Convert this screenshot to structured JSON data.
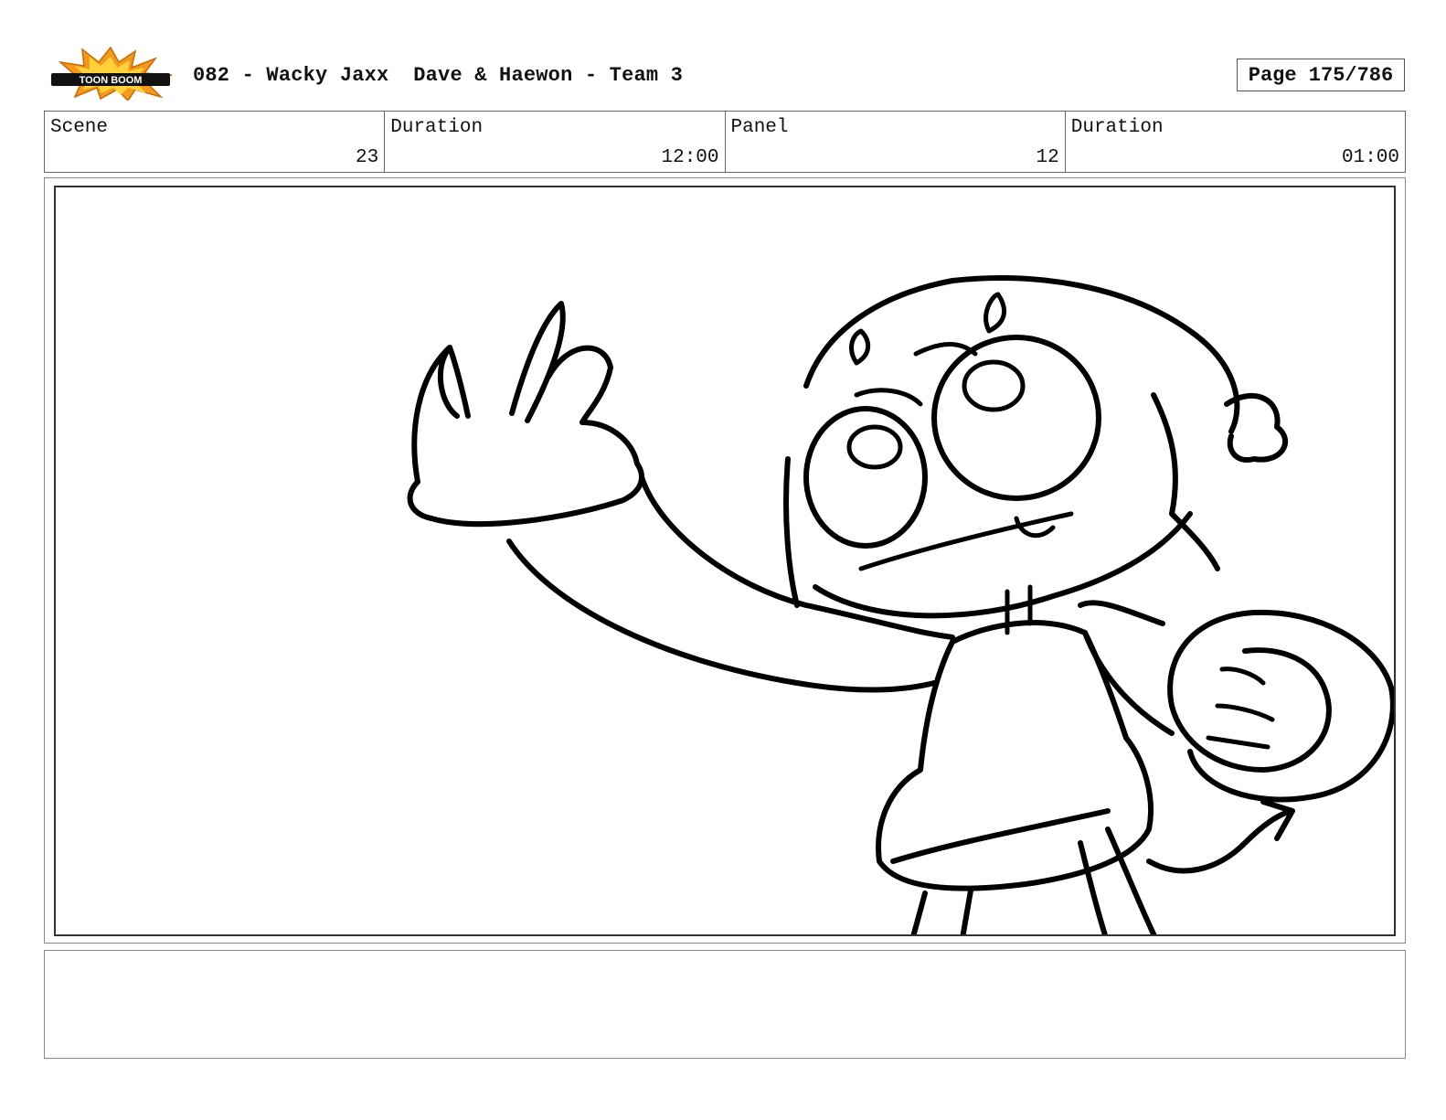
{
  "header": {
    "logo_text": "TOON BOOM",
    "title": "082 - Wacky Jaxx  Dave & Haewon - Team 3",
    "page_label": "Page 175/786"
  },
  "info": {
    "scene_label": "Scene",
    "scene_value": "23",
    "scene_duration_label": "Duration",
    "scene_duration_value": "12:00",
    "panel_label": "Panel",
    "panel_value": "12",
    "panel_duration_label": "Duration",
    "panel_duration_value": "01:00"
  },
  "panel": {
    "drawing": "storyboard-sketch-character-reaching"
  },
  "notes": {
    "text": ""
  },
  "colors": {
    "logo_orange": "#f39a1e",
    "logo_yellow": "#ffd23a",
    "ink": "#000000"
  }
}
